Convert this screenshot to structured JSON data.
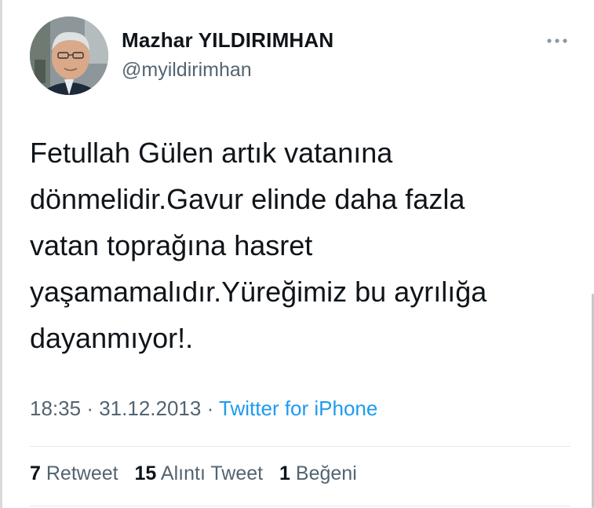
{
  "author": {
    "display_name": "Mazhar YILDIRIMHAN",
    "handle": "@myildirimhan",
    "avatar_icon": "profile-photo"
  },
  "more_icon": "ellipsis-icon",
  "tweet": {
    "text_lines": [
      "Fetullah Gülen artık vatanına",
      "dönmelidir.Gavur elinde daha fazla",
      "vatan toprağına hasret",
      "yaşamamalıdır.Yüreğimiz bu ayrılığa",
      "dayanmıyor!."
    ],
    "time": "18:35",
    "separator": "·",
    "date": "31.12.2013",
    "source": "Twitter for iPhone"
  },
  "stats": {
    "retweets": {
      "count": "7",
      "label": "Retweet"
    },
    "quotes": {
      "count": "15",
      "label": "Alıntı Tweet"
    },
    "likes": {
      "count": "1",
      "label": "Beğeni"
    }
  },
  "colors": {
    "text": "#0f1419",
    "secondary": "#536471",
    "link": "#1d9bf0",
    "divider": "#e1e8ed"
  }
}
